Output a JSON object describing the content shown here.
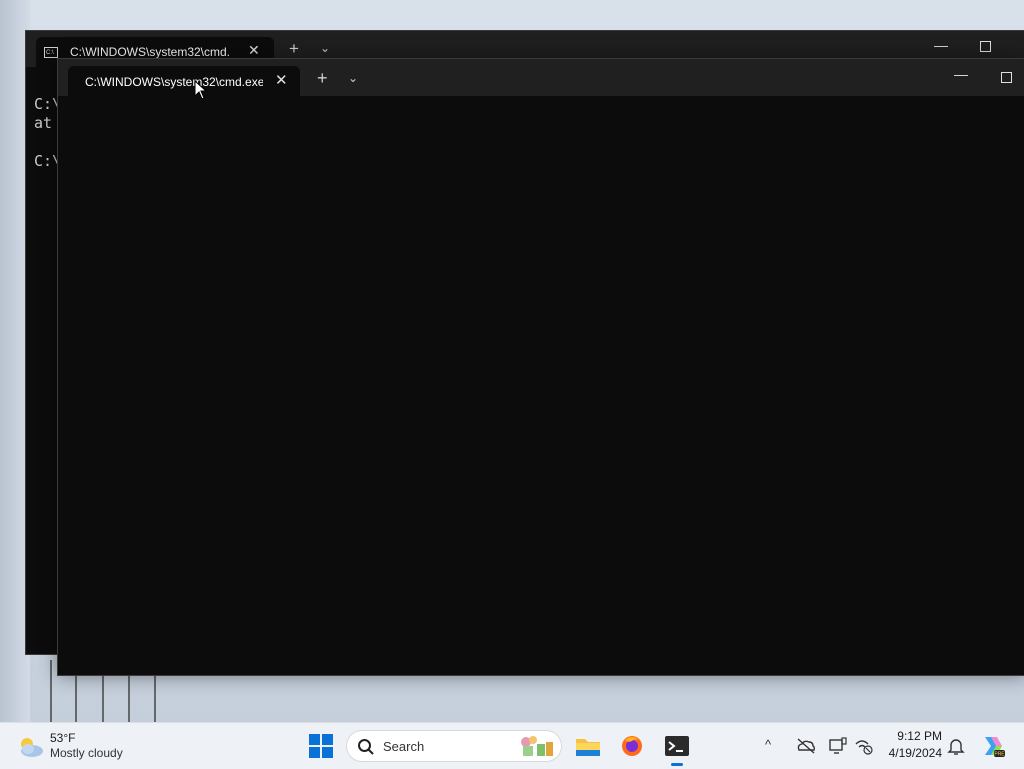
{
  "desktop": {
    "back_window": {
      "tab_title": "C:\\WINDOWS\\system32\\cmd.",
      "tab_icon_text": "C:\\",
      "console_lines": [
        "C:\\",
        "at",
        "",
        "C:\\"
      ]
    },
    "front_window": {
      "tab_title": "C:\\WINDOWS\\system32\\cmd.exe"
    }
  },
  "taskbar": {
    "weather": {
      "temp": "53°F",
      "condition": "Mostly cloudy",
      "icon": "partly-cloudy-icon"
    },
    "search": {
      "placeholder": "Search"
    },
    "apps": [
      {
        "name": "file-explorer",
        "icon": "folder-icon"
      },
      {
        "name": "firefox",
        "icon": "firefox-icon"
      },
      {
        "name": "terminal",
        "icon": "terminal-icon",
        "active": true
      }
    ],
    "tray": {
      "icons": [
        "chevron-up-icon",
        "onedrive-offline-icon",
        "display-icon",
        "network-offline-icon"
      ]
    },
    "clock": {
      "time": "9:12 PM",
      "date": "4/19/2024"
    },
    "colors": {
      "accent": "#0a72d6"
    }
  }
}
